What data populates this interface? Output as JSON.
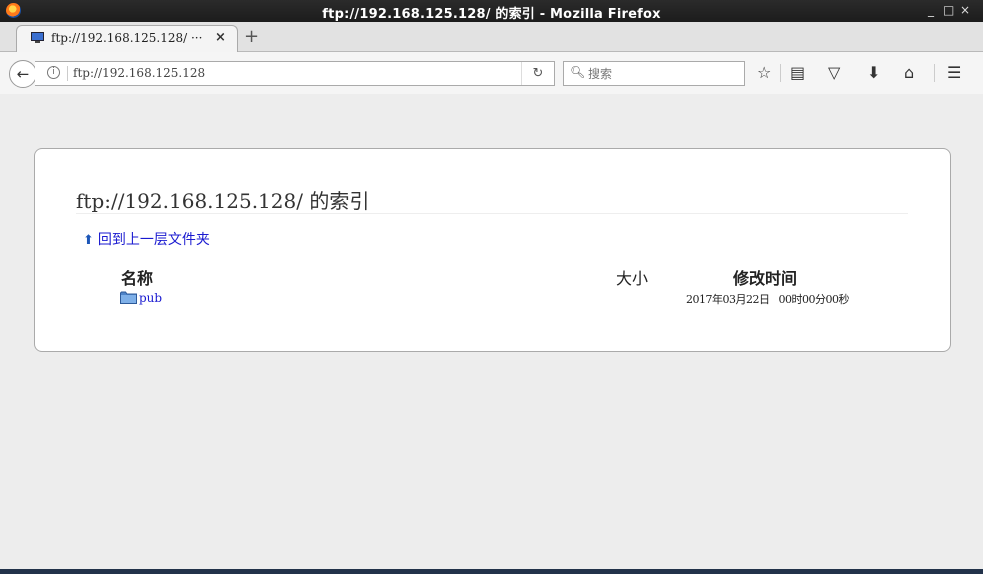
{
  "window": {
    "title": "ftp://192.168.125.128/ 的索引 - Mozilla Firefox",
    "controls": {
      "minimize": "_",
      "maximize": "□",
      "close": "×"
    }
  },
  "tab": {
    "title": "ftp://192.168.125.128/ ···",
    "close": "×",
    "new_tab": "+"
  },
  "navbar": {
    "back": "←",
    "info": "i",
    "url": "ftp://192.168.125.128",
    "reload": "↻",
    "search_placeholder": "搜索",
    "icons": [
      "star-icon",
      "reading-list-icon",
      "pocket-icon",
      "download-icon",
      "home-icon",
      "menu-icon"
    ]
  },
  "page": {
    "title": "ftp://192.168.125.128/ 的索引",
    "up_link": "回到上一层文件夹",
    "columns": {
      "name": "名称",
      "size": "大小",
      "modified": "修改时间"
    },
    "rows": [
      {
        "name": "pub",
        "size": "",
        "date": "2017年03月22日",
        "time": "00时00分00秒"
      }
    ]
  },
  "colors": {
    "link": "#1a1ad0",
    "titlebar": "#1c1c1c",
    "card_border": "#aaaaaa"
  }
}
